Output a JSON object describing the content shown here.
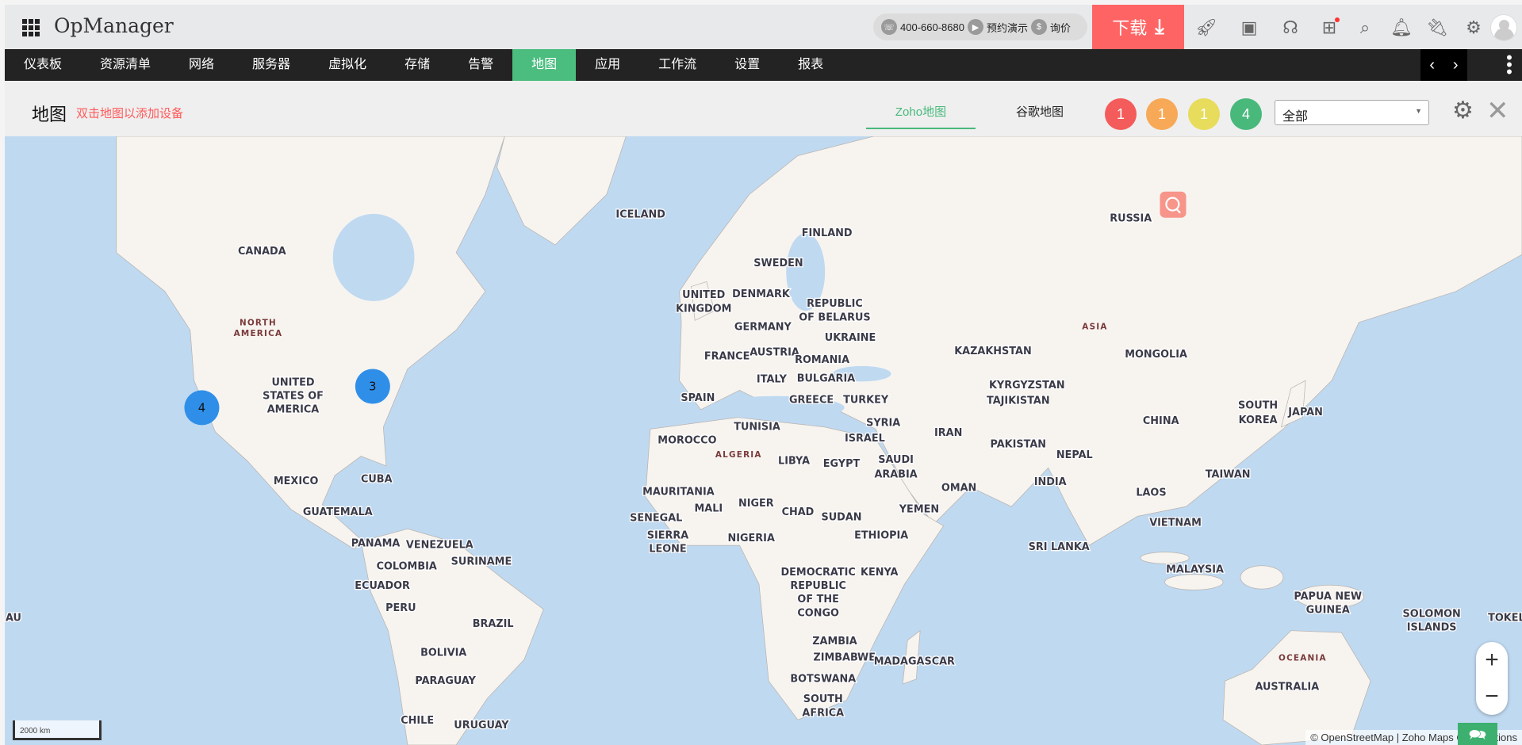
{
  "app": {
    "title": "OpManager"
  },
  "top": {
    "phone": "400-660-8680",
    "demo": "预约演示",
    "price": "询价",
    "download": "下载"
  },
  "nav": {
    "items": [
      "仪表板",
      "资源清单",
      "网络",
      "服务器",
      "虚拟化",
      "存储",
      "告警",
      "地图",
      "应用",
      "工作流",
      "设置",
      "报表"
    ],
    "active": "地图"
  },
  "sub": {
    "title": "地图",
    "hint": "双击地图以添加设备",
    "tabs": [
      "Zoho地图",
      "谷歌地图"
    ],
    "badges": [
      {
        "count": "1",
        "color": "#f45b5b"
      },
      {
        "count": "1",
        "color": "#f7a957"
      },
      {
        "count": "1",
        "color": "#e7dc5c"
      },
      {
        "count": "4",
        "color": "#48b97b"
      }
    ],
    "filter": "全部"
  },
  "map": {
    "clusters": [
      "4",
      "3"
    ],
    "labels": [
      "ICELAND",
      "RUSSIA",
      "CANADA",
      "FINLAND",
      "SWEDEN",
      "UNITED",
      "KINGDOM",
      "DENMARK",
      "REPUBLIC",
      "OF BELARUS",
      "GERMANY",
      "UKRAINE",
      "AUSTRIA",
      "FRANCE",
      "ROMANIA",
      "BULGARIA",
      "ITALY",
      "SPAIN",
      "GREECE",
      "TURKEY",
      "KAZAKHSTAN",
      "MONGOLIA",
      "KYRGYZSTAN",
      "TAJIKISTAN",
      "UNITED",
      "STATES OF",
      "AMERICA",
      "SOUTH",
      "KOREA",
      "JAPAN",
      "CHINA",
      "SYRIA",
      "ISRAEL",
      "IRAN",
      "TUNISIA",
      "MOROCCO",
      "LIBYA",
      "EGYPT",
      "SAUDI",
      "ARABIA",
      "PAKISTAN",
      "NEPAL",
      "INDIA",
      "TAIWAN",
      "OMAN",
      "YEMEN",
      "MEXICO",
      "CUBA",
      "MAURITANIA",
      "MALI",
      "NIGER",
      "CHAD",
      "SUDAN",
      "LAOS",
      "GUATEMALA",
      "SENEGAL",
      "SIERRA",
      "LEONE",
      "NIGERIA",
      "ETHIOPIA",
      "VIETNAM",
      "PANAMA",
      "VENEZUELA",
      "SRI LANKA",
      "COLOMBIA",
      "SURINAME",
      "ECUADOR",
      "DEMOCRATIC",
      "REPUBLIC",
      "OF THE",
      "CONGO",
      "KENYA",
      "MALAYSIA",
      "PERU",
      "BRAZIL",
      "PAPUA NEW",
      "GUINEA",
      "SOLOMON",
      "ISLANDS",
      "TOKEL",
      "AU",
      "ZAMBIA",
      "ZIMBABWE",
      "MADAGASCAR",
      "BOLIVIA",
      "PARAGUAY",
      "BOTSWANA",
      "SOUTH",
      "AFRICA",
      "AUSTRALIA",
      "CHILE",
      "URUGUAY"
    ],
    "continents": [
      "NORTH",
      "AMERICA",
      "ASIA",
      "ALGERIA",
      "OCEANIA"
    ],
    "scale": "2000 km",
    "attribution": "© OpenStreetMap |  Zoho Maps Contributions"
  }
}
